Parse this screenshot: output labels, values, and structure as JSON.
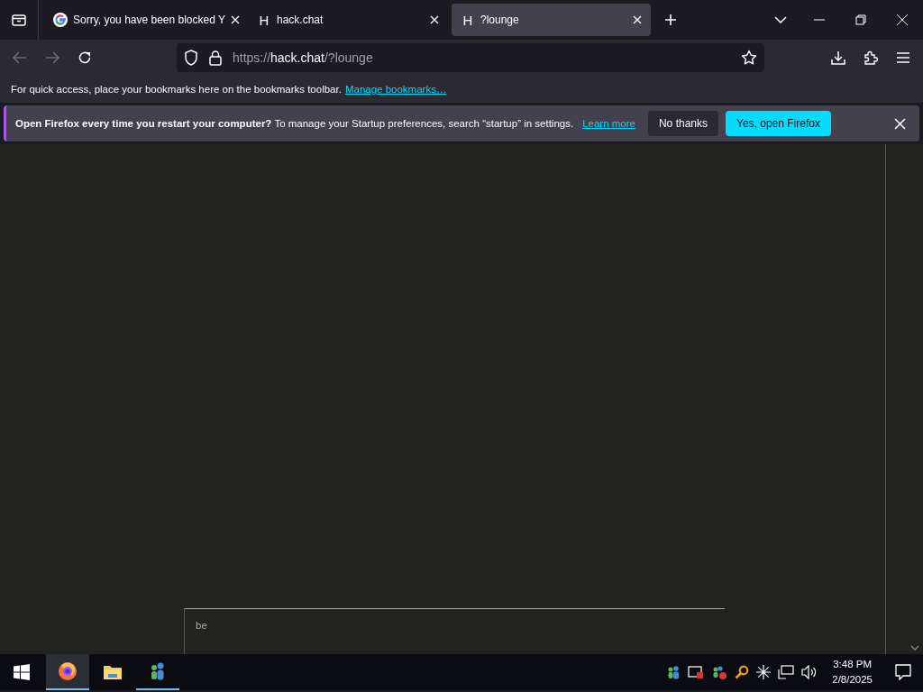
{
  "tabs": [
    {
      "title": "Sorry, you have been blocked Y",
      "favicon": {
        "kind": "google"
      },
      "selected": false
    },
    {
      "title": "hack.chat",
      "favicon": {
        "kind": "letter",
        "text": "H"
      },
      "selected": false
    },
    {
      "title": "?lounge",
      "favicon": {
        "kind": "letter",
        "text": "H"
      },
      "selected": true
    }
  ],
  "address_bar": {
    "scheme": "https://",
    "host": "hack.chat",
    "path": "/?lounge"
  },
  "bookmarks_bar": {
    "text": "For quick access, place your bookmarks here on the bookmarks toolbar.",
    "link": "Manage bookmarks…"
  },
  "notification": {
    "message": "**Open Firefox every time you restart your computer?** To manage your Startup preferences, search “startup” in settings.",
    "link": "Learn more",
    "buttons": [
      {
        "label": "No thanks",
        "kind": "secondary"
      },
      {
        "label": "Yes, open Firefox",
        "kind": "primary"
      }
    ]
  },
  "chat": {
    "input_value": "be"
  },
  "taskbar": {
    "apps": [
      {
        "kind": "firefox",
        "selected": true,
        "running": true
      },
      {
        "kind": "explorer",
        "selected": false,
        "running": false
      },
      {
        "kind": "people",
        "selected": false,
        "running": true
      }
    ],
    "clock": {
      "time": "3:48 PM",
      "date": "2/8/2025"
    }
  }
}
